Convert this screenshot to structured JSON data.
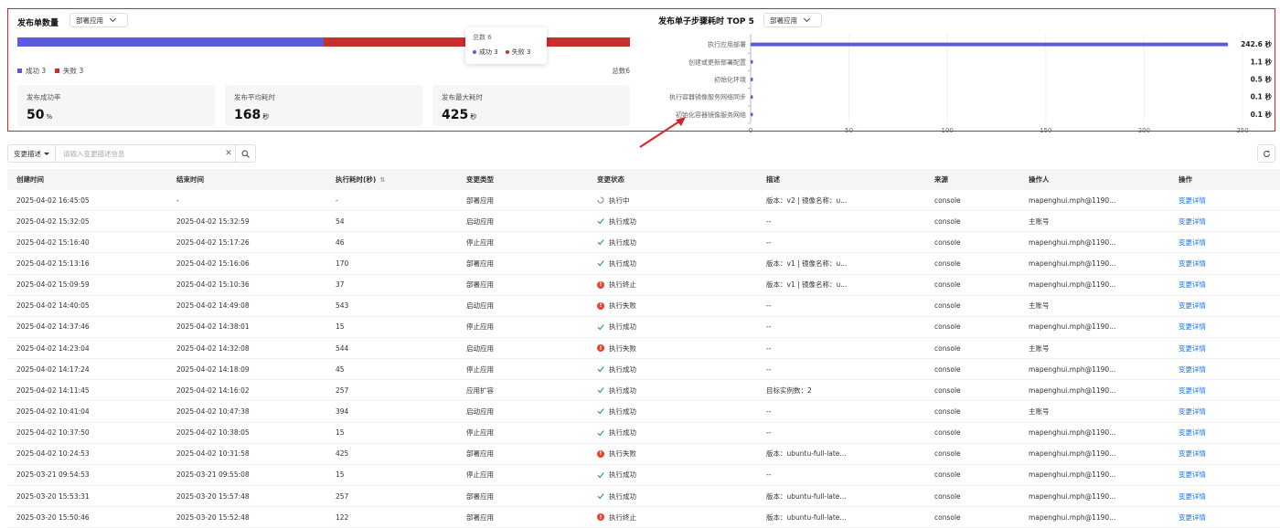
{
  "summary": {
    "title": "发布单数量",
    "filter": "部署应用",
    "success_count": 3,
    "fail_count": 3,
    "legend_success": "成功 3",
    "legend_fail": "失败 3",
    "total_label": "总数6",
    "tooltip": {
      "title": "总数 6",
      "success_label": "成功",
      "success_value": "3",
      "fail_label": "失败",
      "fail_value": "3"
    },
    "colors": {
      "success": "#5b5bdf",
      "fail": "#c8302b"
    },
    "stats": [
      {
        "label": "发布成功率",
        "value": "50",
        "unit": "%"
      },
      {
        "label": "发布平均耗时",
        "value": "168",
        "unit": "秒"
      },
      {
        "label": "发布最大耗时",
        "value": "425",
        "unit": "秒"
      }
    ]
  },
  "step_chart": {
    "title": "发布单子步骤耗时 TOP 5",
    "filter": "部署应用"
  },
  "chart_data": {
    "type": "bar",
    "orientation": "horizontal",
    "categories": [
      "执行应用部署",
      "创建或更新部署配置",
      "初始化环境",
      "执行容器镜像服务网络同步",
      "初始化容器镜像服务网络"
    ],
    "values": [
      242.6,
      1.1,
      0.5,
      0.1,
      0.1
    ],
    "value_labels": [
      "242.6 秒",
      "1.1 秒",
      "0.5 秒",
      "0.1 秒",
      "0.1 秒"
    ],
    "xticks": [
      0,
      50,
      100,
      150,
      200,
      250
    ],
    "xlim": [
      0,
      250
    ],
    "color": "#5b5bdf",
    "grid": true
  },
  "toolbar": {
    "search_type": "变更描述",
    "search_placeholder": "请输入变更描述信息"
  },
  "table": {
    "headers": [
      "创建时间",
      "结束时间",
      "执行耗时(秒)",
      "变更类型",
      "变更状态",
      "描述",
      "来源",
      "操作人",
      "操作"
    ],
    "sort_icon": "⇅",
    "rows": [
      [
        "2025-04-02 16:45:05",
        "-",
        "-",
        "部署应用",
        "执行中",
        "版本：v2 | 镜像名称：u...",
        "console",
        "mapenghui.mph@1190...",
        "变更详情"
      ],
      [
        "2025-04-02 15:32:05",
        "2025-04-02 15:32:59",
        "54",
        "启动应用",
        "执行成功",
        "--",
        "console",
        "主账号",
        "变更详情"
      ],
      [
        "2025-04-02 15:16:40",
        "2025-04-02 15:17:26",
        "46",
        "停止应用",
        "执行成功",
        "--",
        "console",
        "mapenghui.mph@1190...",
        "变更详情"
      ],
      [
        "2025-04-02 15:13:16",
        "2025-04-02 15:16:06",
        "170",
        "部署应用",
        "执行成功",
        "版本：v1 | 镜像名称：u...",
        "console",
        "mapenghui.mph@1190...",
        "变更详情"
      ],
      [
        "2025-04-02 15:09:59",
        "2025-04-02 15:10:36",
        "37",
        "部署应用",
        "执行终止",
        "版本：v1 | 镜像名称：u...",
        "console",
        "mapenghui.mph@1190...",
        "变更详情"
      ],
      [
        "2025-04-02 14:40:05",
        "2025-04-02 14:49:08",
        "543",
        "启动应用",
        "执行失败",
        "--",
        "console",
        "主账号",
        "变更详情"
      ],
      [
        "2025-04-02 14:37:46",
        "2025-04-02 14:38:01",
        "15",
        "停止应用",
        "执行成功",
        "--",
        "console",
        "mapenghui.mph@1190...",
        "变更详情"
      ],
      [
        "2025-04-02 14:23:04",
        "2025-04-02 14:32:08",
        "544",
        "启动应用",
        "执行失败",
        "--",
        "console",
        "主账号",
        "变更详情"
      ],
      [
        "2025-04-02 14:17:24",
        "2025-04-02 14:18:09",
        "45",
        "停止应用",
        "执行成功",
        "--",
        "console",
        "mapenghui.mph@1190...",
        "变更详情"
      ],
      [
        "2025-04-02 14:11:45",
        "2025-04-02 14:16:02",
        "257",
        "应用扩容",
        "执行成功",
        "目标实例数：2",
        "console",
        "mapenghui.mph@1190...",
        "变更详情"
      ],
      [
        "2025-04-02 10:41:04",
        "2025-04-02 10:47:38",
        "394",
        "启动应用",
        "执行成功",
        "--",
        "console",
        "主账号",
        "变更详情"
      ],
      [
        "2025-04-02 10:37:50",
        "2025-04-02 10:38:05",
        "15",
        "停止应用",
        "执行成功",
        "--",
        "console",
        "mapenghui.mph@1190...",
        "变更详情"
      ],
      [
        "2025-04-02 10:24:53",
        "2025-04-02 10:31:58",
        "425",
        "部署应用",
        "执行失败",
        "版本：ubuntu-full-late...",
        "console",
        "mapenghui.mph@1190...",
        "变更详情"
      ],
      [
        "2025-03-21 09:54:53",
        "2025-03-21 09:55:08",
        "15",
        "停止应用",
        "执行成功",
        "--",
        "console",
        "mapenghui.mph@1190...",
        "变更详情"
      ],
      [
        "2025-03-20 15:53:31",
        "2025-03-20 15:57:48",
        "257",
        "部署应用",
        "执行成功",
        "版本：ubuntu-full-late...",
        "console",
        "mapenghui.mph@1190...",
        "变更详情"
      ],
      [
        "2025-03-20 15:50:46",
        "2025-03-20 15:52:48",
        "122",
        "部署应用",
        "执行终止",
        "版本：ubuntu-full-late...",
        "console",
        "mapenghui.mph@1190...",
        "变更详情"
      ]
    ]
  }
}
